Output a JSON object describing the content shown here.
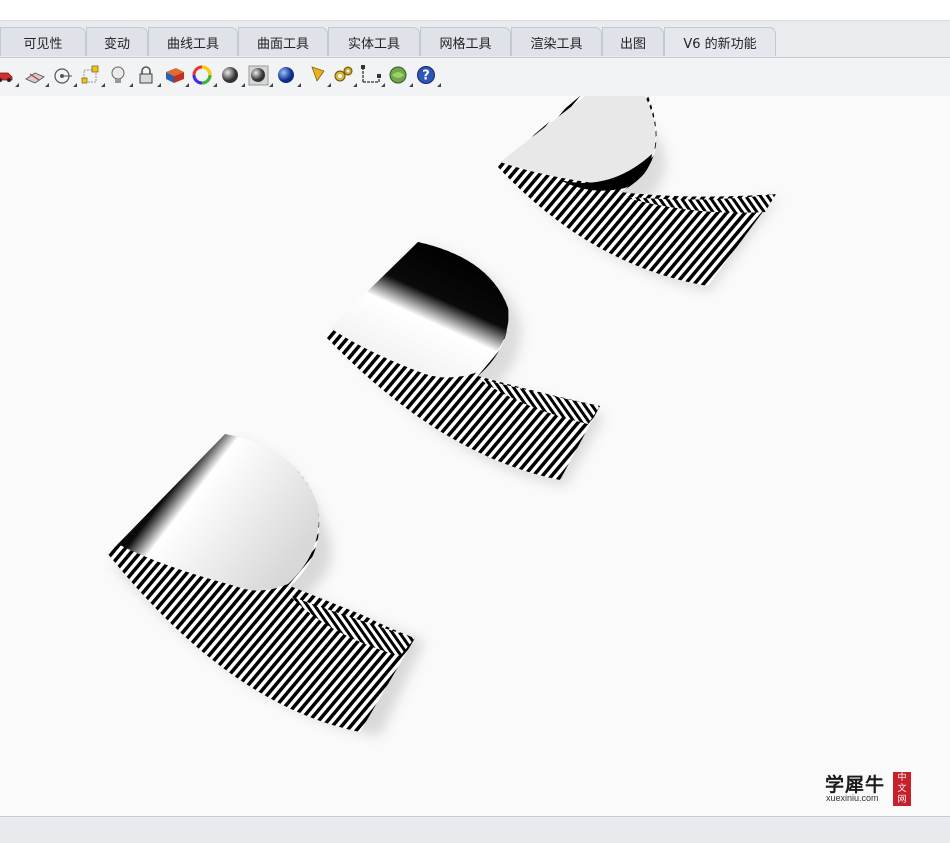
{
  "tabs": [
    {
      "label": "可见性"
    },
    {
      "label": "变动"
    },
    {
      "label": "曲线工具"
    },
    {
      "label": "曲面工具"
    },
    {
      "label": "实体工具"
    },
    {
      "label": "网格工具"
    },
    {
      "label": "渲染工具"
    },
    {
      "label": "出图"
    },
    {
      "label": "V6 的新功能"
    }
  ],
  "toolbar_icons": [
    "car-icon",
    "sketch-plane-icon",
    "target-icon",
    "bounding-box-icon",
    "lightbulb-icon",
    "lock-icon",
    "book-layer-icon",
    "color-wheel-icon",
    "shaded-sphere-icon",
    "rendered-sphere-icon",
    "blue-sphere-icon",
    "spotlight-icon",
    "gears-icon",
    "dimension-icon",
    "globe-icon",
    "help-icon"
  ],
  "watermark": {
    "title": "学犀牛",
    "site": "xuexiniu.com",
    "seal": [
      "中",
      "文",
      "网"
    ]
  },
  "colors": {
    "tab_bg": "#dfe2e8",
    "viewport_bg": "#fafafa",
    "seal_red": "#c8202a"
  }
}
